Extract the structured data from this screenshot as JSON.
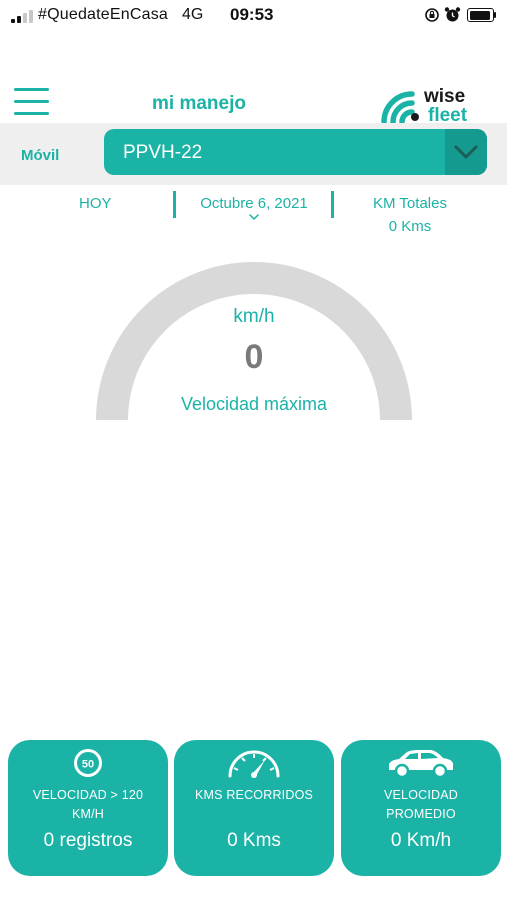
{
  "status_bar": {
    "carrier": "#QuedateEnCasa",
    "network": "4G",
    "time": "09:53"
  },
  "header": {
    "title": "mi manejo",
    "logo": {
      "line1": "wise",
      "line2": "fleet"
    }
  },
  "vehicle": {
    "label": "Móvil",
    "selected": "PPVH-22"
  },
  "summary": {
    "period": "HOY",
    "date": "Octubre 6, 2021",
    "km_total_label": "KM Totales",
    "km_total_value": "0 Kms"
  },
  "gauge": {
    "unit": "km/h",
    "value": "0",
    "label": "Velocidad máxima"
  },
  "cards": [
    {
      "icon": "speed-limit-icon",
      "badge": "50",
      "label": "VELOCIDAD > 120 KM/H",
      "value": "0 registros"
    },
    {
      "icon": "odometer-icon",
      "label": "KMS RECORRIDOS",
      "value": "0 Kms"
    },
    {
      "icon": "car-icon",
      "label": "VELOCIDAD PROMEDIO",
      "value": "0 Km/h"
    }
  ],
  "colors": {
    "accent": "#1bb3a6",
    "accent_dark": "#149a8f",
    "gauge_track": "#d9d9d9",
    "gauge_value": "#7a7a7a"
  }
}
